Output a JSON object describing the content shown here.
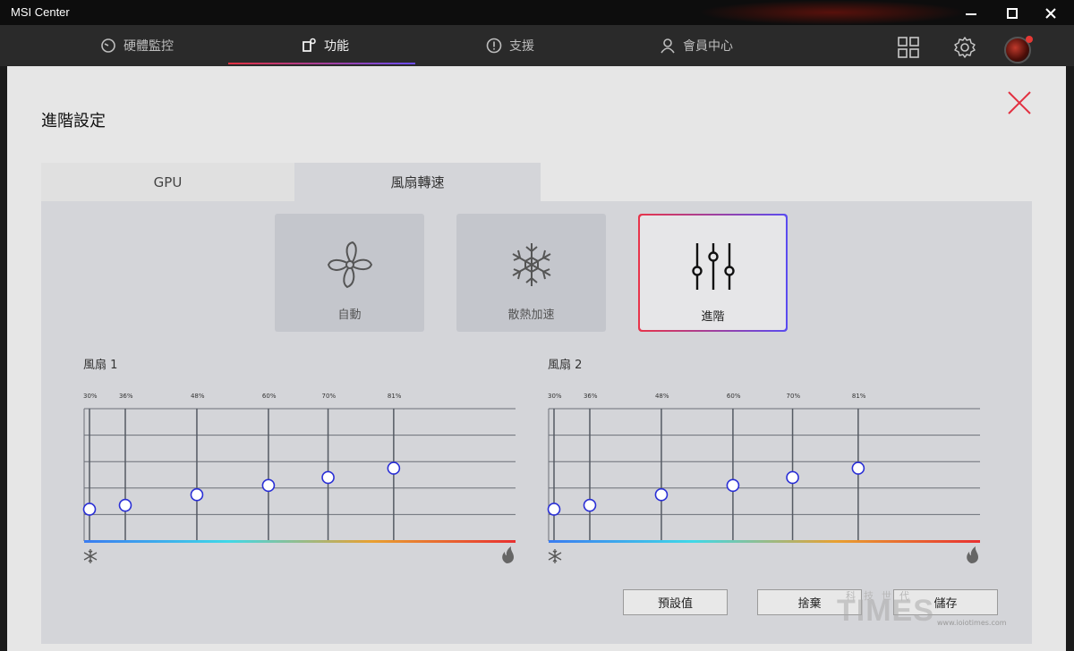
{
  "window": {
    "title": "MSI Center"
  },
  "nav": {
    "tabs": [
      {
        "label": "硬體監控",
        "icon": "gauge-icon"
      },
      {
        "label": "功能",
        "icon": "feature-icon",
        "active": true
      },
      {
        "label": "支援",
        "icon": "help-icon"
      },
      {
        "label": "會員中心",
        "icon": "user-icon"
      }
    ],
    "icons": [
      "grid-icon",
      "gear-icon",
      "avatar"
    ]
  },
  "dialog": {
    "title": "進階設定",
    "subtabs": [
      {
        "label": "GPU"
      },
      {
        "label": "風扇轉速",
        "active": true
      }
    ],
    "modes": [
      {
        "label": "自動",
        "icon": "fan-icon"
      },
      {
        "label": "散熱加速",
        "icon": "snowflake-icon"
      },
      {
        "label": "進階",
        "icon": "sliders-icon",
        "selected": true
      }
    ],
    "fans": [
      {
        "title": "風扇 1"
      },
      {
        "title": "風扇 2"
      }
    ],
    "buttons": {
      "default": "預設值",
      "discard": "捨棄",
      "save": "儲存"
    }
  },
  "chart_data": [
    {
      "type": "line",
      "title": "風扇 1",
      "x_labels": [
        "30%",
        "36%",
        "48%",
        "60%",
        "70%",
        "81%"
      ],
      "x": [
        30,
        36,
        48,
        60,
        70,
        81
      ],
      "y": [
        24,
        27,
        35,
        42,
        48,
        55
      ],
      "ylim": [
        0,
        100
      ],
      "grid": true,
      "colors": {
        "point": "#2a2fd6",
        "gradient": [
          "#3a7cf0",
          "#3fd8e8",
          "#e8a030",
          "#e83030"
        ]
      }
    },
    {
      "type": "line",
      "title": "風扇 2",
      "x_labels": [
        "30%",
        "36%",
        "48%",
        "60%",
        "70%",
        "81%"
      ],
      "x": [
        30,
        36,
        48,
        60,
        70,
        81
      ],
      "y": [
        24,
        27,
        35,
        42,
        48,
        55
      ],
      "ylim": [
        0,
        100
      ],
      "grid": true,
      "colors": {
        "point": "#2a2fd6",
        "gradient": [
          "#3a7cf0",
          "#3fd8e8",
          "#e8a030",
          "#e83030"
        ]
      }
    }
  ],
  "watermark": {
    "small": "科技世代",
    "big": "TIMES",
    "url": "www.ioiotimes.com"
  },
  "colors": {
    "accent_red": "#e23040",
    "accent_blue": "#6a4df0",
    "dialog_bg": "#e6e6e6",
    "panel_bg": "#d4d5d9"
  }
}
